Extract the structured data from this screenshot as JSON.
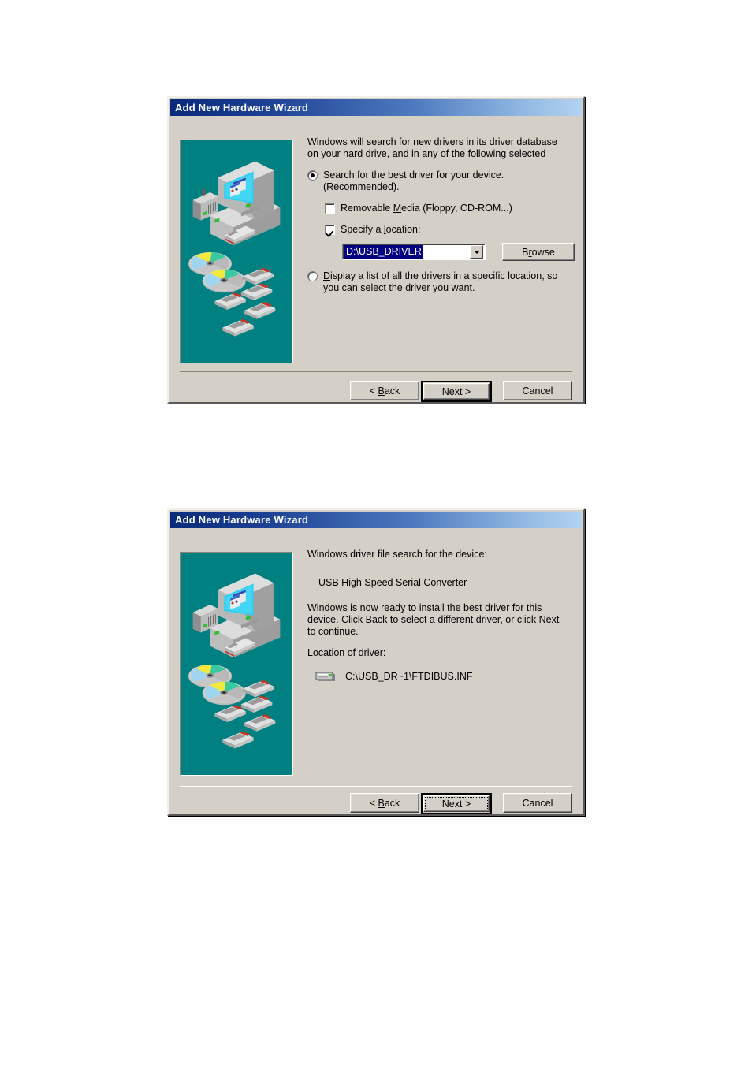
{
  "dialogs": [
    {
      "title": "Add New Hardware Wizard",
      "intro": "Windows will search for new drivers in its driver database\non your hard drive, and in any of the following selected",
      "options": {
        "search_best_driver": {
          "label": "Search for the best driver for your device.\n(Recommended).",
          "selected": true
        },
        "removable_media": {
          "label": "Removable Media (Floppy, CD-ROM...)",
          "checked": false
        },
        "specify_location": {
          "label": "Specify a location:",
          "checked": true
        },
        "display_list": {
          "label": "Display a list of all the drivers in a specific location, so\nyou can select the driver you want.",
          "selected": false
        }
      },
      "location_combo": {
        "value": "D:\\USB_DRIVER",
        "selected_text": true
      },
      "browse_label": "Browse",
      "buttons": {
        "back": "< Back",
        "next": "Next >",
        "cancel": "Cancel",
        "default": "next"
      }
    },
    {
      "title": "Add New Hardware Wizard",
      "intro": "Windows driver file search for the device:",
      "device_name": "USB High Speed Serial Converter",
      "ready_text": "Windows is now ready to install the best driver for this\ndevice. Click Back to select a different driver, or click Next\nto continue.",
      "location_label": "Location of driver:",
      "driver_path": "C:\\USB_DR~1\\FTDIBUS.INF",
      "drive_icon": "hard-drive-icon",
      "buttons": {
        "back": "< Back",
        "next": "Next >",
        "cancel": "Cancel",
        "default": "next",
        "focused": "next"
      }
    }
  ],
  "colors": {
    "dialog_face": "#d4d0c8",
    "title_gradient_start": "#0a2a7a",
    "title_gradient_end": "#b4d2f0",
    "illustration_background": "#008080",
    "selection_blue": "#000080",
    "monitor_screen": "#33ccf0",
    "page_background": "#ffffff"
  },
  "illustration": {
    "name": "computer-media-illustration",
    "items": [
      "crt-monitor",
      "desktop-tower",
      "external-drive",
      "floppy-slot",
      "compact-disc",
      "compact-disc",
      "floppy-disk",
      "floppy-disk",
      "floppy-disk",
      "floppy-disk",
      "floppy-disk"
    ]
  }
}
